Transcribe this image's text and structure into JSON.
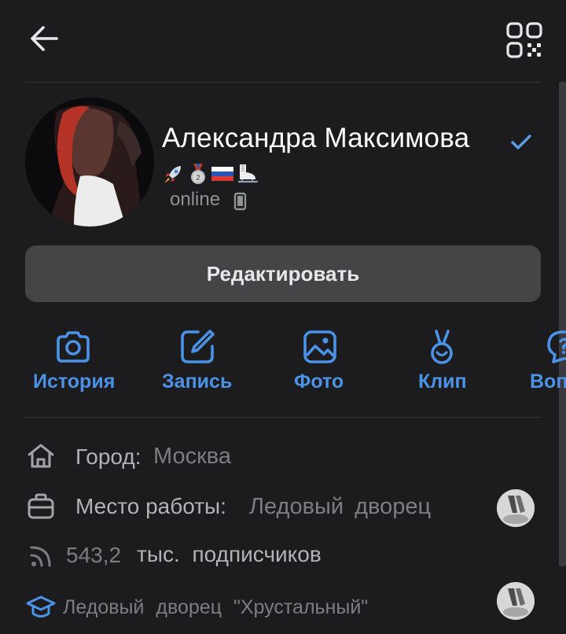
{
  "header": {
    "back_icon": "arrow-left-icon",
    "qr_icon": "qr-code-icon"
  },
  "profile": {
    "name": "Александра Максимова",
    "verified_icon": "checkmark-icon",
    "status_emojis": [
      "rocket",
      "silver-medal",
      "russia-flag",
      "ice-skate"
    ],
    "online_status": "online",
    "device_icon": "phone-icon"
  },
  "edit_button": {
    "label": "Редактировать"
  },
  "actions": [
    {
      "label": "История",
      "icon": "camera-icon"
    },
    {
      "label": "Запись",
      "icon": "edit-icon"
    },
    {
      "label": "Фото",
      "icon": "image-icon"
    },
    {
      "label": "Клип",
      "icon": "clip-icon"
    },
    {
      "label": "Воп",
      "icon": "question-bubble-icon"
    }
  ],
  "info": {
    "city_key": "Город:",
    "city_value": "Москва",
    "work_key": "Место работы:",
    "work_value": "Ледовый дворец",
    "followers_count": "543,2",
    "followers_text": "тыс. подписчиков",
    "education_value": "Ледовый дворец \"Хрустальный\""
  },
  "colors": {
    "background": "#1c1b1e",
    "accent": "#4a93e6",
    "button": "#454548",
    "verified": "#5d9de6"
  }
}
